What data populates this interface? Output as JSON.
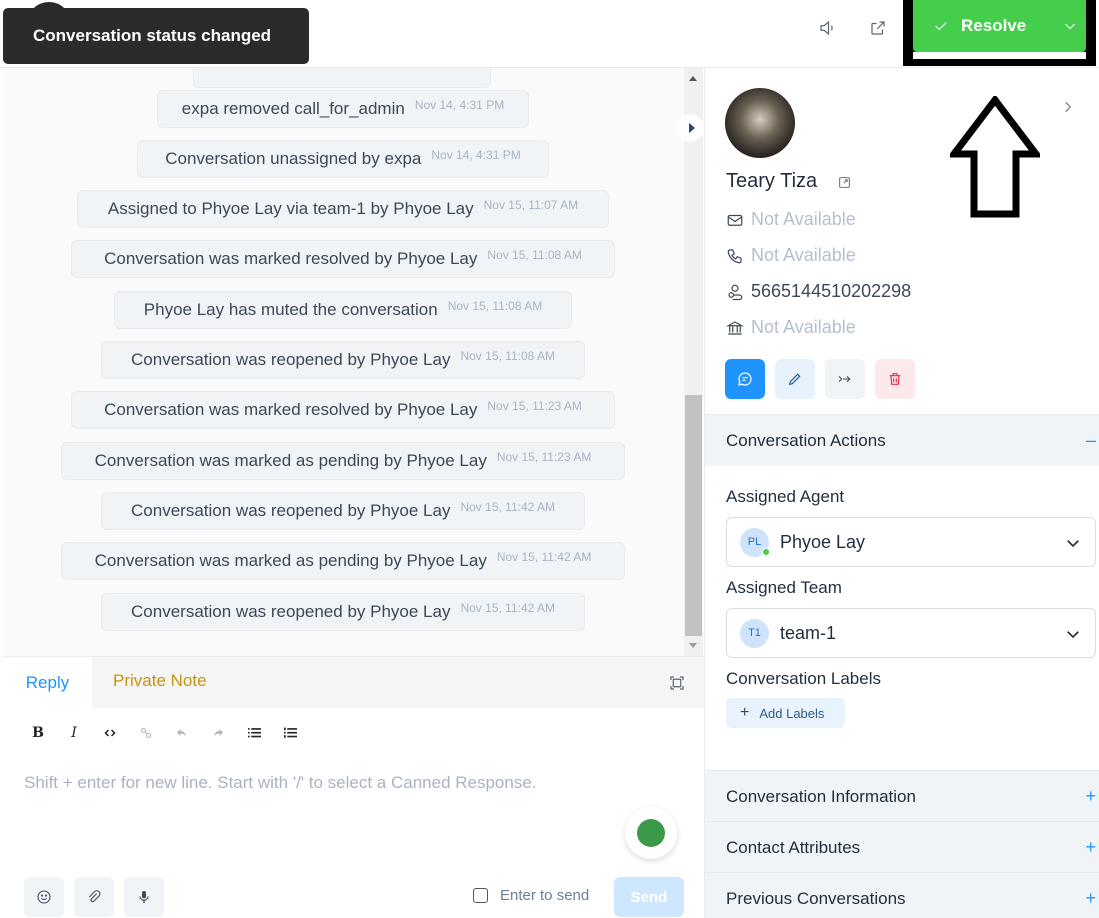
{
  "toast": {
    "message": "Conversation status changed"
  },
  "header": {
    "resolve_label": "Resolve",
    "colors": {
      "resolve_bg": "#44ce4b"
    }
  },
  "messages": [
    {
      "text": "expa removed call_for_admin",
      "time": "Nov 14, 4:31 PM"
    },
    {
      "text": "Conversation unassigned by expa",
      "time": "Nov 14, 4:31 PM"
    },
    {
      "text": "Assigned to Phyoe Lay via team-1 by Phyoe Lay",
      "time": "Nov 15, 11:07 AM"
    },
    {
      "text": "Conversation was marked resolved by Phyoe Lay",
      "time": "Nov 15, 11:08 AM"
    },
    {
      "text": "Phyoe Lay has muted the conversation",
      "time": "Nov 15, 11:08 AM"
    },
    {
      "text": "Conversation was reopened by Phyoe Lay",
      "time": "Nov 15, 11:08 AM"
    },
    {
      "text": "Conversation was marked resolved by Phyoe Lay",
      "time": "Nov 15, 11:23 AM"
    },
    {
      "text": "Conversation was marked as pending by Phyoe Lay",
      "time": "Nov 15, 11:23 AM"
    },
    {
      "text": "Conversation was reopened by Phyoe Lay",
      "time": "Nov 15, 11:42 AM"
    },
    {
      "text": "Conversation was marked as pending by Phyoe Lay",
      "time": "Nov 15, 11:42 AM"
    },
    {
      "text": "Conversation was reopened by Phyoe Lay",
      "time": "Nov 15, 11:42 AM"
    }
  ],
  "reply": {
    "tab_reply": "Reply",
    "tab_private_note": "Private Note",
    "toolbar": {
      "bold": "B",
      "italic": "I"
    },
    "placeholder": "Shift + enter for new line. Start with '/' to select a Canned Response.",
    "enter_to_send": "Enter to send",
    "send_label": "Send"
  },
  "contact": {
    "name": "Teary Tiza",
    "email": "Not Available",
    "phone": "Not Available",
    "identifier": "5665144510202298",
    "company": "Not Available"
  },
  "sidebar": {
    "conversation_actions": "Conversation Actions",
    "assigned_agent_label": "Assigned Agent",
    "assigned_agent": {
      "initials": "PL",
      "name": "Phyoe Lay",
      "online": true
    },
    "assigned_team_label": "Assigned Team",
    "assigned_team": {
      "initials": "T1",
      "name": "team-1"
    },
    "labels_label": "Conversation Labels",
    "add_labels": "Add Labels",
    "sections": [
      {
        "title": "Conversation Information",
        "sign": "+"
      },
      {
        "title": "Contact Attributes",
        "sign": "+"
      },
      {
        "title": "Previous Conversations",
        "sign": "+"
      }
    ],
    "collapse_sign": "–"
  }
}
